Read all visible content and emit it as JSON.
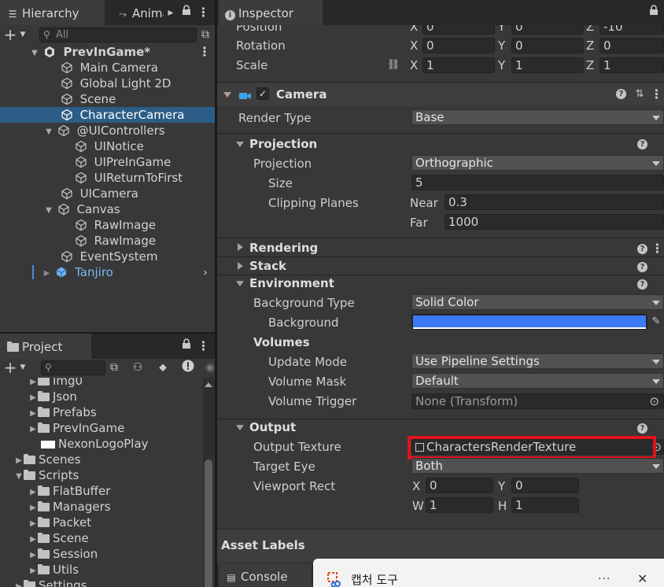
{
  "hierarchy": {
    "tabs": [
      {
        "label": "Hierarchy"
      },
      {
        "label": "Anima"
      }
    ],
    "search_placeholder": "All",
    "items": [
      {
        "label": "PrevInGame*"
      },
      {
        "label": "Main Camera"
      },
      {
        "label": "Global Light 2D"
      },
      {
        "label": "Scene"
      },
      {
        "label": "CharacterCamera"
      },
      {
        "label": "@UIControllers"
      },
      {
        "label": "UINotice"
      },
      {
        "label": "UIPreInGame"
      },
      {
        "label": "UIReturnToFirst"
      },
      {
        "label": "UICamera"
      },
      {
        "label": "Canvas"
      },
      {
        "label": "RawImage"
      },
      {
        "label": "RawImage"
      },
      {
        "label": "EventSystem"
      },
      {
        "label": "Tanjiro"
      }
    ]
  },
  "project": {
    "tab_label": "Project",
    "items": [
      {
        "label": "Img0"
      },
      {
        "label": "Json"
      },
      {
        "label": "Prefabs"
      },
      {
        "label": "PrevInGame"
      },
      {
        "label": "NexonLogoPlay"
      },
      {
        "label": "Scenes"
      },
      {
        "label": "Scripts"
      },
      {
        "label": "FlatBuffer"
      },
      {
        "label": "Managers"
      },
      {
        "label": "Packet"
      },
      {
        "label": "Scene"
      },
      {
        "label": "Session"
      },
      {
        "label": "Utils"
      },
      {
        "label": "Settings"
      }
    ]
  },
  "inspector": {
    "tab_label": "Inspector",
    "transform": {
      "position": {
        "label": "Position",
        "x": "0",
        "y": "0",
        "z": "-10"
      },
      "rotation": {
        "label": "Rotation",
        "x": "0",
        "y": "0",
        "z": "0"
      },
      "scale": {
        "label": "Scale",
        "x": "1",
        "y": "1",
        "z": "1"
      },
      "axis_x": "X",
      "axis_y": "Y",
      "axis_z": "Z"
    },
    "camera": {
      "title": "Camera",
      "render_type_label": "Render Type",
      "render_type_value": "Base",
      "projection_header": "Projection",
      "projection_label": "Projection",
      "projection_value": "Orthographic",
      "size_label": "Size",
      "size_value": "5",
      "clipping_label": "Clipping Planes",
      "near_label": "Near",
      "near_value": "0.3",
      "far_label": "Far",
      "far_value": "1000",
      "rendering_header": "Rendering",
      "stack_header": "Stack",
      "environment_header": "Environment",
      "bg_type_label": "Background Type",
      "bg_type_value": "Solid Color",
      "background_label": "Background",
      "background_color": "#3a7bf5",
      "volumes_label": "Volumes",
      "update_mode_label": "Update Mode",
      "update_mode_value": "Use Pipeline Settings",
      "volume_mask_label": "Volume Mask",
      "volume_mask_value": "Default",
      "volume_trigger_label": "Volume Trigger",
      "volume_trigger_value": "None (Transform)",
      "output_header": "Output",
      "output_texture_label": "Output Texture",
      "output_texture_value": "CharactersRenderTexture",
      "target_eye_label": "Target Eye",
      "target_eye_value": "Both",
      "viewport_label": "Viewport Rect",
      "vp_x_label": "X",
      "vp_x": "0",
      "vp_y_label": "Y",
      "vp_y": "0",
      "vp_w_label": "W",
      "vp_w": "1",
      "vp_h_label": "H",
      "vp_h": "1"
    },
    "asset_labels": "Asset Labels"
  },
  "console": {
    "tab_label": "Console"
  },
  "snipping_tool": {
    "title": "캡처 도구"
  },
  "highlight_color": "#e0141c"
}
